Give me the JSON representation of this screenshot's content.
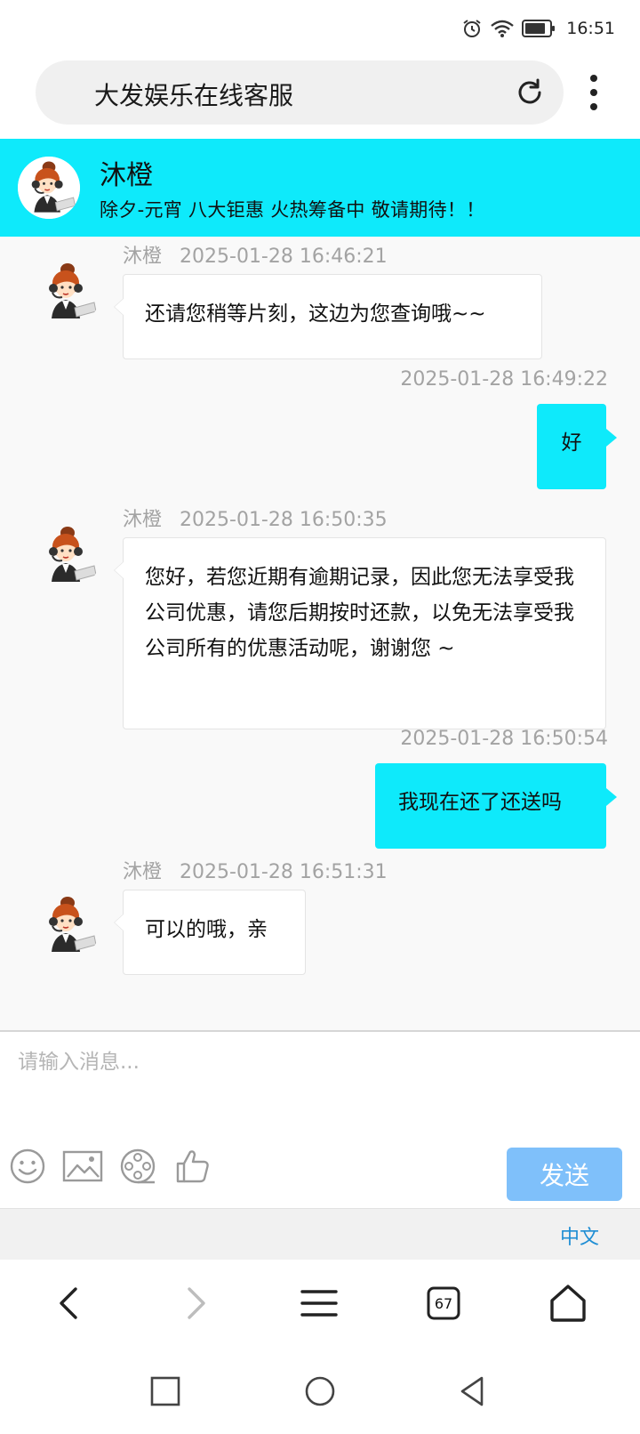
{
  "status_bar": {
    "time": "16:51"
  },
  "browser": {
    "page_title": "大发娱乐在线客服",
    "tab_count": "67"
  },
  "chat_header": {
    "agent_name": "沐橙",
    "notice": "除夕-元宵 八大钜惠 火热筹备中 敬请期待！！"
  },
  "messages": [
    {
      "from": "agent",
      "sender": "沐橙",
      "time": "2025-01-28 16:46:21",
      "text": "还请您稍等片刻，这边为您查询哦~~"
    },
    {
      "from": "user",
      "sender": "",
      "time": "2025-01-28 16:49:22",
      "text": "好"
    },
    {
      "from": "agent",
      "sender": "沐橙",
      "time": "2025-01-28 16:50:35",
      "text": "您好，若您近期有逾期记录，因此您无法享受我公司优惠，请您后期按时还款，以免无法享受我公司所有的优惠活动呢，谢谢您 ~"
    },
    {
      "from": "user",
      "sender": "",
      "time": "2025-01-28 16:50:54",
      "text": "我现在还了还送吗"
    },
    {
      "from": "agent",
      "sender": "沐橙",
      "time": "2025-01-28 16:51:31",
      "text": "可以的哦，亲"
    }
  ],
  "composer": {
    "placeholder": "请输入消息...",
    "send_label": "发送"
  },
  "language": {
    "current": "中文"
  },
  "colors": {
    "accent": "#0eeafb",
    "send_button": "#7fc0fa",
    "link": "#1f8ed4"
  }
}
